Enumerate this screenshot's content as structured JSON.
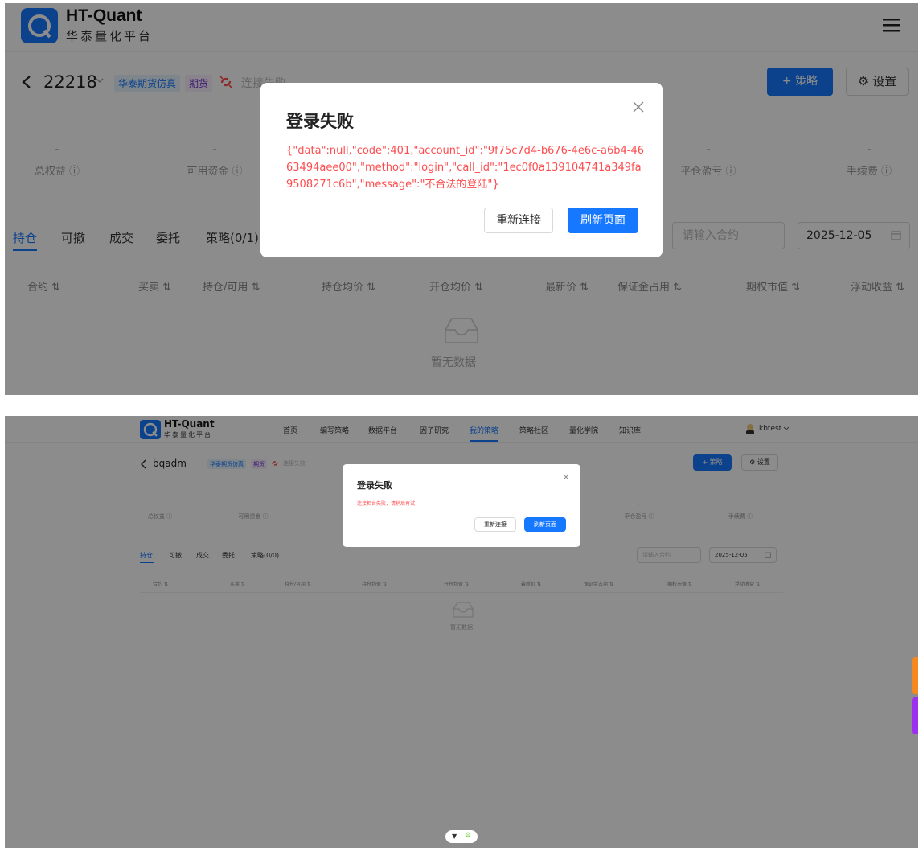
{
  "panel1": {
    "logo": {
      "title": "HT-Quant",
      "subtitle": "华泰量化平台"
    },
    "account": {
      "id": "22218",
      "broker_tag": "华泰期货仿真",
      "type_tag": "期货",
      "status": "连接失败"
    },
    "buttons": {
      "add_strategy": "+ 策略",
      "settings": "设置"
    },
    "stats": [
      {
        "value": "-",
        "label": "总权益 ⓘ"
      },
      {
        "value": "-",
        "label": "可用资金 ⓘ"
      },
      {
        "value": "-",
        "label": "平仓盈亏 ⓘ"
      },
      {
        "value": "-",
        "label": "手续费 ⓘ"
      }
    ],
    "tabs": [
      "持仓",
      "可撤",
      "成交",
      "委托",
      "策略(0/1)"
    ],
    "search_placeholder": "请输入合约",
    "date": "2025-12-05",
    "columns": [
      "合约 ⇅",
      "买卖 ⇅",
      "持仓/可用 ⇅",
      "持仓均价 ⇅",
      "开仓均价 ⇅",
      "最新价 ⇅",
      "保证金占用 ⇅",
      "期权市值 ⇅",
      "浮动收益 ⇅"
    ],
    "empty_text": "暂无数据",
    "modal": {
      "title": "登录失败",
      "message": "{\"data\":null,\"code\":401,\"account_id\":\"9f75c7d4-b676-4e6c-a6b4-4663494aee00\",\"method\":\"login\",\"call_id\":\"1ec0f0a139104741a349fa9508271c6b\",\"message\":\"不合法的登陆\"}",
      "reconnect": "重新连接",
      "refresh": "刷新页面"
    }
  },
  "panel2": {
    "logo": {
      "title": "HT-Quant",
      "subtitle": "华泰量化平台"
    },
    "nav": [
      "首页",
      "编写策略",
      "数据平台",
      "因子研究",
      "我的策略",
      "策略社区",
      "量化学院",
      "知识库"
    ],
    "active_nav": "我的策略",
    "user": "kbtest",
    "account": {
      "id": "bqadm",
      "broker_tag": "华泰期货仿真",
      "type_tag": "期货",
      "status": "连接失败"
    },
    "buttons": {
      "add_strategy": "+ 策略",
      "settings": "设置"
    },
    "stats": [
      {
        "value": "-",
        "label": "总权益 ⓘ"
      },
      {
        "value": "-",
        "label": "可用资金 ⓘ"
      },
      {
        "value": "-",
        "label": "平仓盈亏 ⓘ"
      },
      {
        "value": "-",
        "label": "手续费 ⓘ"
      }
    ],
    "tabs": [
      "持仓",
      "可撤",
      "成交",
      "委托",
      "策略(0/0)"
    ],
    "search_placeholder": "请输入合约",
    "date": "2025-12-05",
    "columns": [
      "合约 ⇅",
      "买卖 ⇅",
      "持仓/可用 ⇅",
      "持仓均价 ⇅",
      "开仓均价 ⇅",
      "最新价 ⇅",
      "保证金占用 ⇅",
      "期权市值 ⇅",
      "浮动收益 ⇅"
    ],
    "empty_text": "暂无数据",
    "modal": {
      "title": "登录失败",
      "message": "连接柜台失败，请稍后再试",
      "reconnect": "重新连接",
      "refresh": "刷新页面"
    }
  },
  "colors": {
    "primary": "#1677ff",
    "error": "#ff4d4f",
    "overlay": "rgba(0,0,0,0.45)"
  }
}
